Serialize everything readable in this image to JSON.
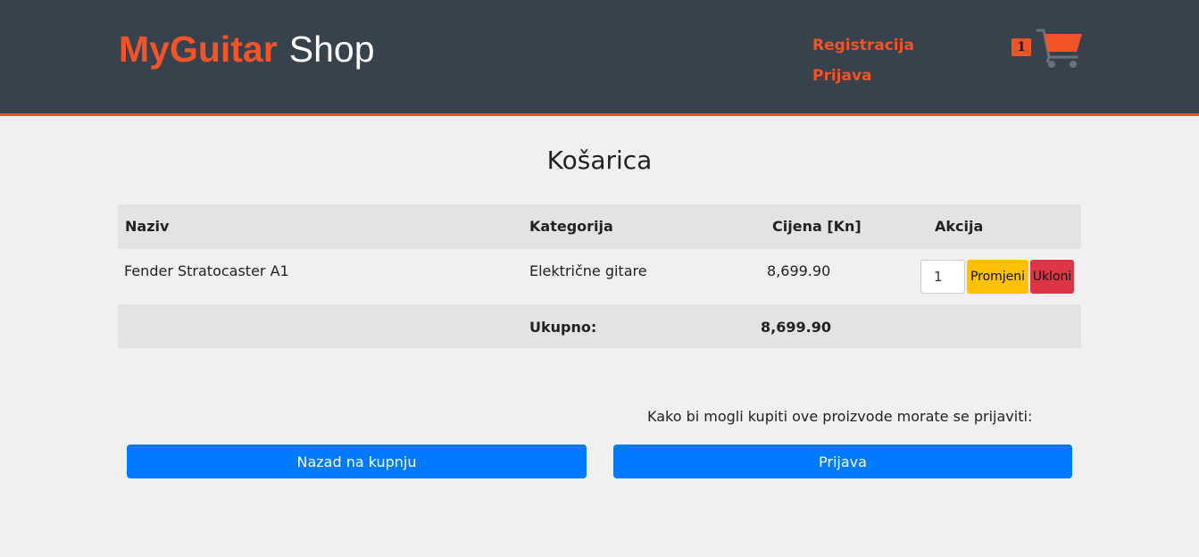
{
  "header": {
    "logo_brand": "MyGuitar",
    "logo_shop": "Shop",
    "nav_register": "Registracija",
    "nav_login": "Prijava",
    "cart_count": "1"
  },
  "page": {
    "title": "Košarica"
  },
  "table": {
    "columns": [
      "Naziv",
      "Kategorija",
      "Cijena [Kn]",
      "Akcija"
    ],
    "rows": [
      {
        "name": "Fender Stratocaster A1",
        "category": "Električne gitare",
        "price": "8,699.90",
        "quantity": "1",
        "change_label": "Promjeni",
        "remove_label": "Ukloni"
      }
    ],
    "total_label": "Ukupno:",
    "total_value": "8,699.90"
  },
  "footer": {
    "notice": "Kako bi mogli kupiti ove proizvode morate se prijaviti:",
    "back_button": "Nazad na kupnju",
    "login_button": "Prijava"
  },
  "colors": {
    "header_bg": "#37424c",
    "accent": "#f05428",
    "primary": "#007bff",
    "warning": "#ffc107",
    "danger": "#dc3545"
  },
  "icons": [
    "shopping-cart-icon"
  ]
}
